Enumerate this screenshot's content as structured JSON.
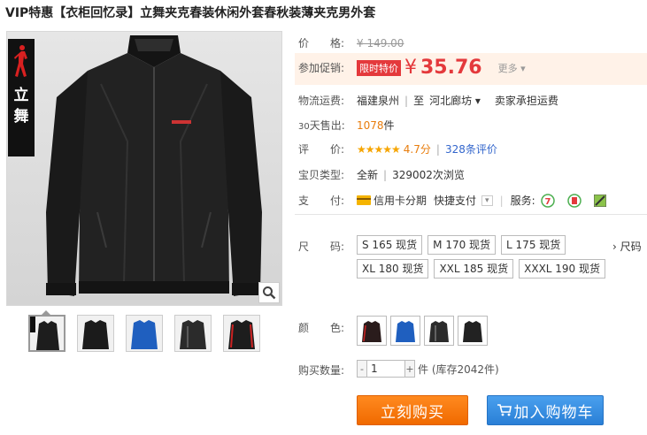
{
  "product": {
    "title": "VIP特惠【衣柜回忆录】立舞夹克春装休闲外套春秋装薄夹克男外套",
    "brand_text": "立舞"
  },
  "price": {
    "label": "价　　格:",
    "original": "¥ 149.00"
  },
  "promo": {
    "label": "参加促销:",
    "tag": "限时特价",
    "currency": "¥",
    "price": "35.76",
    "more": "更多 ▾"
  },
  "shipping": {
    "label": "物流运费:",
    "from": "福建泉州",
    "to_prefix": "至",
    "to": "河北廊坊 ▾",
    "fee": "卖家承担运费"
  },
  "sales": {
    "label_prefix": "30",
    "label": "天售出:",
    "count": "1078",
    "unit": "件"
  },
  "rating": {
    "label": "评　　价:",
    "stars": "★★★★★",
    "score": "4.7分",
    "reviews": "328条评价"
  },
  "item_type": {
    "label": "宝贝类型:",
    "condition": "全新",
    "views": "329002次浏览"
  },
  "payment": {
    "label": "支　　付:",
    "credit": "信用卡分期",
    "quick": "快捷支付",
    "services_label": "服务:"
  },
  "sizes": {
    "label": "尺　　码:",
    "options": [
      "S 165 现货",
      "M 170 现货",
      "L 175 现货",
      "XL 180 现货",
      "XXL 185 现货",
      "XXXL 190 现货"
    ],
    "chart_link": "› 尺码"
  },
  "colors": {
    "label": "颜　　色:",
    "swatches": [
      "#2a1c1c",
      "#1f5fbf",
      "#2b2b2b",
      "#222222"
    ]
  },
  "quantity": {
    "label": "购买数量:",
    "minus": "-",
    "value": "1",
    "plus": "+",
    "stock": "件 (库存2042件)"
  },
  "actions": {
    "buy_now": "立刻购买",
    "add_cart": "加入购物车"
  },
  "accent_colors": {
    "price_red": "#e4393c",
    "buy_orange": "#f07800",
    "cart_blue": "#2f86dd"
  }
}
